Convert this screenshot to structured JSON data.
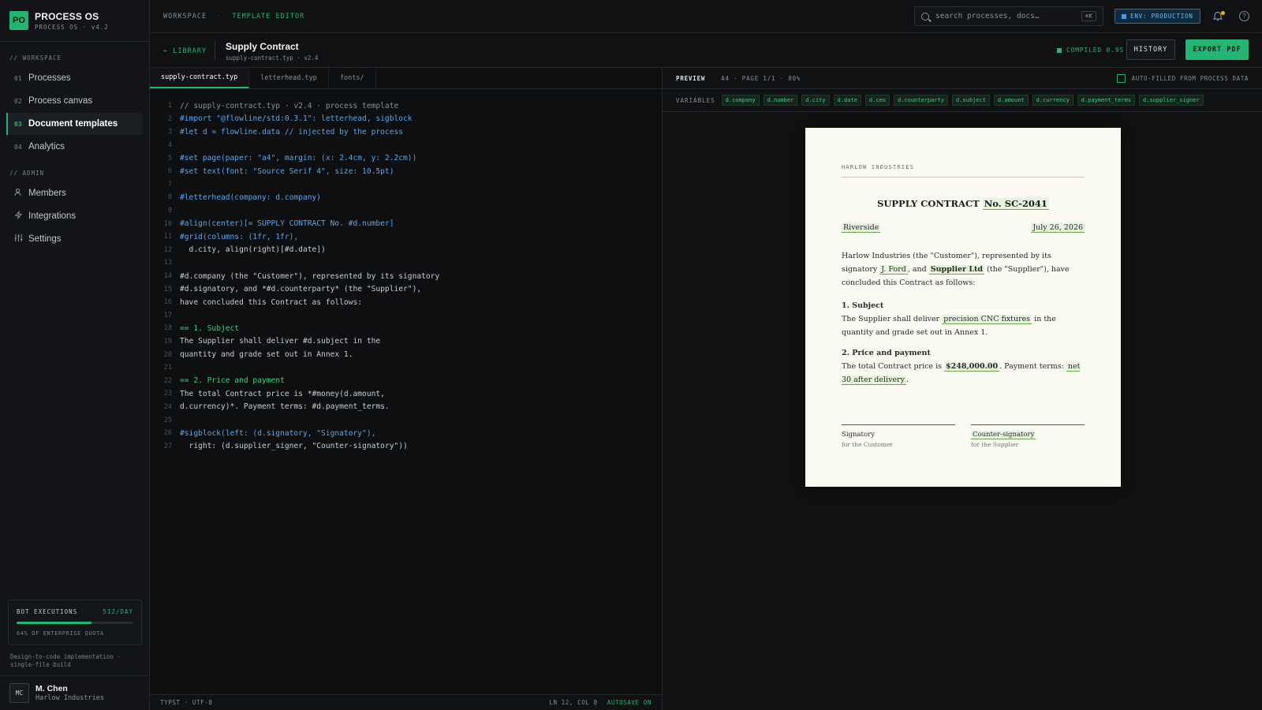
{
  "brand": {
    "logo": "PO",
    "name": "PROCESS OS",
    "sub": "PROCESS OS · v4.2"
  },
  "sidebar": {
    "workspace_label": "// WORKSPACE",
    "workspace_items": [
      {
        "num": "01",
        "label": "Processes"
      },
      {
        "num": "02",
        "label": "Process canvas"
      },
      {
        "num": "03",
        "label": "Document templates",
        "active": true
      },
      {
        "num": "04",
        "label": "Analytics"
      }
    ],
    "admin_label": "// ADMIN",
    "admin_items": [
      {
        "icon": "members-icon",
        "label": "Members"
      },
      {
        "icon": "bolt-icon",
        "label": "Integrations"
      },
      {
        "icon": "sliders-icon",
        "label": "Settings"
      }
    ],
    "quota": {
      "label": "BOT EXECUTIONS",
      "value": "512/DAY",
      "fill": 0.64,
      "foot": "64% OF ENTERPRISE QUOTA"
    },
    "impl_note": "Design-to-code implementation · single-file build",
    "user": {
      "initials": "MC",
      "name": "M. Chen",
      "org": "Harlow Industries"
    }
  },
  "topbar": {
    "crumb_root": "WORKSPACE",
    "crumb_current": "TEMPLATE EDITOR",
    "search_placeholder": "search processes, docs…",
    "search_kbd": "⌘K",
    "env": "ENV: PRODUCTION",
    "accent": "#22b573",
    "env_color": "#3aa0f0"
  },
  "editor_header": {
    "library": "← LIBRARY",
    "title": "Supply Contract",
    "subtitle": "supply-contract.typ · v2.4",
    "compiled": "COMPILED 0.9S",
    "history": "HISTORY",
    "export": "EXPORT PDF"
  },
  "code": {
    "tabs": [
      "supply-contract.typ",
      "letterhead.typ",
      "fonts/"
    ],
    "lines": [
      {
        "n": "1",
        "t": "// supply-contract.typ · v2.4 · process template",
        "s": "c"
      },
      {
        "n": "2",
        "t": "#import \"@flowline/std:0.3.1\": letterhead, sigblock",
        "s": "k"
      },
      {
        "n": "3",
        "t": "#let d = flowline.data // injected by the process",
        "s": "k"
      },
      {
        "n": "4",
        "t": "",
        "s": ""
      },
      {
        "n": "5",
        "t": "#set page(paper: \"a4\", margin: (x: 2.4cm, y: 2.2cm))",
        "s": "k"
      },
      {
        "n": "6",
        "t": "#set text(font: \"Source Serif 4\", size: 10.5pt)",
        "s": "k"
      },
      {
        "n": "7",
        "t": "",
        "s": ""
      },
      {
        "n": "8",
        "t": "#letterhead(company: d.company)",
        "s": "k"
      },
      {
        "n": "9",
        "t": "",
        "s": ""
      },
      {
        "n": "10",
        "t": "#align(center)[= SUPPLY CONTRACT No. #d.number]",
        "s": "k"
      },
      {
        "n": "11",
        "t": "#grid(columns: (1fr, 1fr),",
        "s": "k"
      },
      {
        "n": "12",
        "t": "  d.city, align(right)[#d.date])",
        "s": ""
      },
      {
        "n": "13",
        "t": "",
        "s": ""
      },
      {
        "n": "14",
        "t": "#d.company (the \"Customer\"), represented by its signatory",
        "s": ""
      },
      {
        "n": "15",
        "t": "#d.signatory, and *#d.counterparty* (the \"Supplier\"),",
        "s": ""
      },
      {
        "n": "16",
        "t": "have concluded this Contract as follows:",
        "s": ""
      },
      {
        "n": "17",
        "t": "",
        "s": ""
      },
      {
        "n": "18",
        "t": "== 1. Subject",
        "s": "h"
      },
      {
        "n": "19",
        "t": "The Supplier shall deliver #d.subject in the",
        "s": ""
      },
      {
        "n": "20",
        "t": "quantity and grade set out in Annex 1.",
        "s": ""
      },
      {
        "n": "21",
        "t": "",
        "s": ""
      },
      {
        "n": "22",
        "t": "== 2. Price and payment",
        "s": "h"
      },
      {
        "n": "23",
        "t": "The total Contract price is *#money(d.amount,",
        "s": ""
      },
      {
        "n": "24",
        "t": "d.currency)*. Payment terms: #d.payment_terms.",
        "s": ""
      },
      {
        "n": "25",
        "t": "",
        "s": ""
      },
      {
        "n": "26",
        "t": "#sigblock(left: (d.signatory, \"Signatory\"),",
        "s": "k"
      },
      {
        "n": "27",
        "t": "  right: (d.supplier_signer, \"Counter-signatory\"))",
        "s": ""
      }
    ],
    "status_left": "TYPST · UTF-8",
    "status_right": "LN 12, COL 8",
    "autosave": "AUTOSAVE ON"
  },
  "preview": {
    "label": "PREVIEW",
    "meta": "A4 · PAGE 1/1 · 80%",
    "autofill": "AUTO-FILLED FROM PROCESS DATA",
    "variables_label": "VARIABLES",
    "variables": [
      "d.company",
      "d.number",
      "d.city",
      "d.date",
      "d.ceo",
      "d.counterparty",
      "d.subject",
      "d.amount",
      "d.currency",
      "d.payment_terms",
      "d.supplier_signer"
    ],
    "doc": {
      "letterhead": "HARLOW INDUSTRIES",
      "title": "SUPPLY CONTRACT",
      "number": "No. SC-2041",
      "city": "Riverside",
      "date": "July 26, 2026",
      "p1_a": "Harlow Industries (the \"Customer\"), represented by its signatory ",
      "signatory": "J. Ford",
      "p1_b": ", and ",
      "supplier": "Supplier Ltd",
      "p1_c": " (the \"Supplier\"), have concluded this Contract as follows:",
      "h1": "1. Subject",
      "s1_a": "The Supplier shall deliver ",
      "subject": "precision CNC fixtures",
      "s1_b": " in the quantity and grade set out in Annex 1.",
      "h2": "2. Price and payment",
      "s2_a": "The total Contract price is ",
      "amount": "$248,000.00",
      "s2_b": ". Payment terms: ",
      "terms": "net 30 after delivery",
      "s2_c": ".",
      "sig_left": "Signatory",
      "sig_left_sub": "for the Customer",
      "sig_right": "Counter-signatory",
      "sig_right_sub": "for the Supplier"
    }
  }
}
